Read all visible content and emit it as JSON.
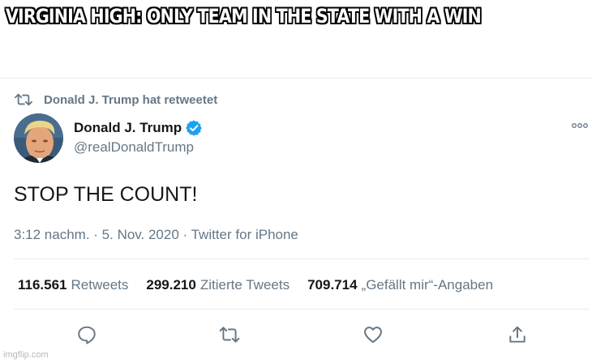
{
  "meme": {
    "caption": "VIRGINIA HIGH: ONLY TEAM IN THE STATE WITH A WIN"
  },
  "tweet": {
    "retweet_notice": "Donald J. Trump hat retweetet",
    "display_name": "Donald J. Trump",
    "handle": "@realDonaldTrump",
    "text": "STOP THE COUNT!",
    "meta": "3:12 nachm. · 5. Nov. 2020 · Twitter for iPhone",
    "stats": [
      {
        "count": "116.561",
        "label": "Retweets"
      },
      {
        "count": "299.210",
        "label": "Zitierte Tweets"
      },
      {
        "count": "709.714",
        "label": "„Gefällt mir“-Angaben"
      }
    ],
    "icons": {
      "retweet_notice": "retweet-icon",
      "verified": "verified-badge-icon",
      "more": "more-options-icon",
      "reply": "reply-icon",
      "retweet": "retweet-icon",
      "like": "heart-icon",
      "share": "share-icon"
    }
  },
  "watermark": "imgflip.com",
  "colors": {
    "primary_text": "#14171a",
    "secondary_text": "#657786",
    "verified_blue": "#1da1f2",
    "divider": "#e6ecf0"
  }
}
